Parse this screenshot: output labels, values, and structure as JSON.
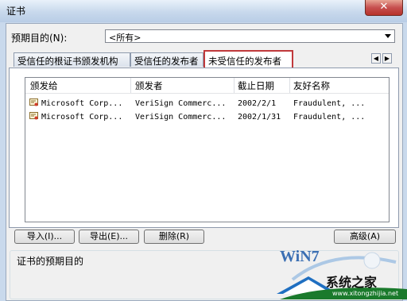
{
  "window": {
    "title": "证书",
    "close_symbol": "✕"
  },
  "purpose": {
    "label": "预期目的(N):",
    "value": "<所有>"
  },
  "tabs": [
    {
      "label": "受信任的根证书颁发机构"
    },
    {
      "label": "受信任的发布者"
    },
    {
      "label": "未受信任的发布者"
    }
  ],
  "tab_nav": {
    "prev": "◀",
    "next": "▶"
  },
  "table": {
    "headers": [
      "颁发给",
      "颁发者",
      "截止日期",
      "友好名称"
    ],
    "rows": [
      [
        "Microsoft Corp...",
        "VeriSign Commerc...",
        "2002/2/1",
        "Fraudulent, ..."
      ],
      [
        "Microsoft Corp...",
        "VeriSign Commerc...",
        "2002/1/31",
        "Fraudulent, ..."
      ]
    ]
  },
  "buttons": {
    "import": "导入(I)...",
    "export": "导出(E)...",
    "remove": "删除(R)",
    "advanced": "高级(A)"
  },
  "group": {
    "title": "证书的预期目的"
  },
  "watermark": {
    "logo": "WiN7",
    "site": "系统之家",
    "url": "www.xitongzhijia.net"
  },
  "colors": {
    "active_tab_outline": "#c0393b",
    "close_button": "#c75050"
  }
}
